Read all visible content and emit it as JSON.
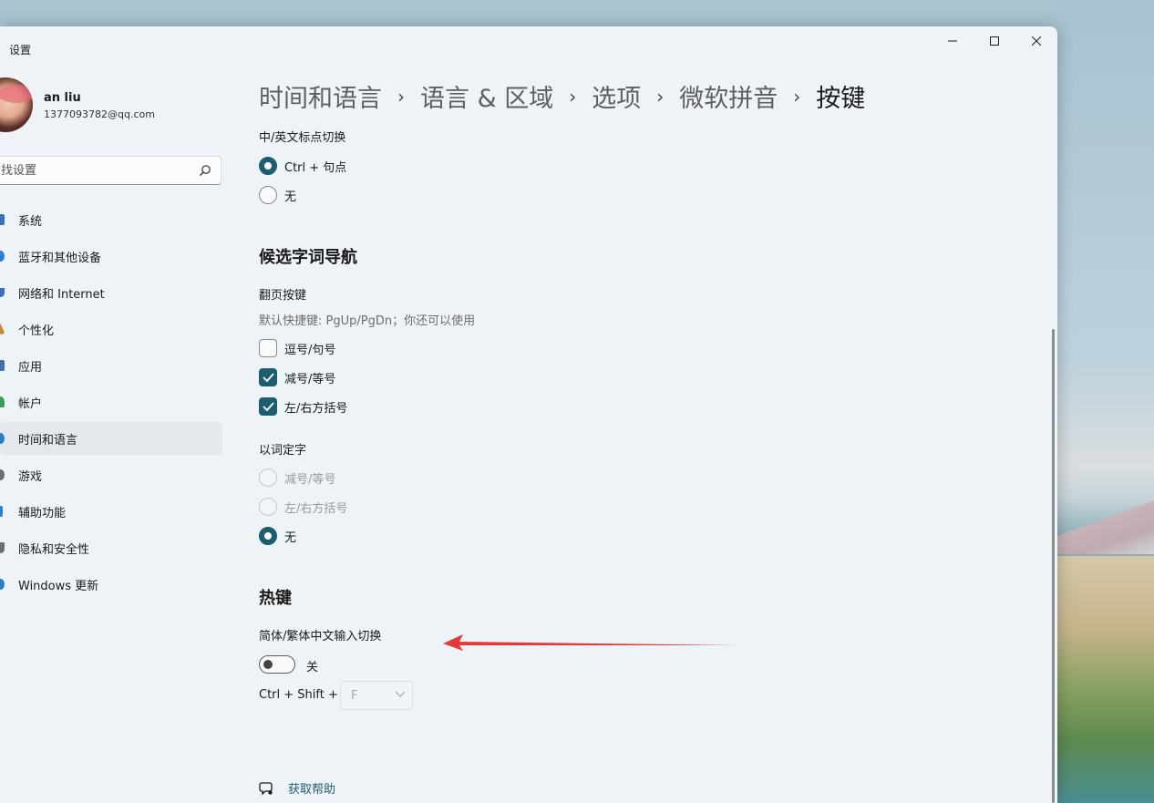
{
  "window": {
    "title": "设置",
    "minimize_icon": "minimize-icon",
    "maximize_icon": "maximize-icon",
    "close_icon": "close-icon"
  },
  "profile": {
    "name": "an liu",
    "email": "1377093782@qq.com"
  },
  "search": {
    "placeholder": "找设置",
    "icon": "search-icon"
  },
  "nav": {
    "items": [
      {
        "label": "系统",
        "icon": "system-icon",
        "color": "#3b6fb6"
      },
      {
        "label": "蓝牙和其他设备",
        "icon": "bluetooth-icon",
        "color": "#2f7fd0"
      },
      {
        "label": "网络和 Internet",
        "icon": "network-icon",
        "color": "#3b6fb6"
      },
      {
        "label": "个性化",
        "icon": "brush-icon",
        "color": "#c58a3a"
      },
      {
        "label": "应用",
        "icon": "apps-icon",
        "color": "#4a6fa8"
      },
      {
        "label": "帐户",
        "icon": "account-icon",
        "color": "#3f9a5a"
      },
      {
        "label": "时间和语言",
        "icon": "globe-icon",
        "color": "#2e7fc0"
      },
      {
        "label": "游戏",
        "icon": "game-icon",
        "color": "#6e6e6e"
      },
      {
        "label": "辅助功能",
        "icon": "accessibility-icon",
        "color": "#2e7fc0"
      },
      {
        "label": "隐私和安全性",
        "icon": "shield-icon",
        "color": "#6e6e6e"
      },
      {
        "label": "Windows 更新",
        "icon": "update-icon",
        "color": "#2e7fc0"
      }
    ],
    "active_index": 6
  },
  "breadcrumb": {
    "items": [
      "时间和语言",
      "语言 & 区域",
      "选项",
      "微软拼音"
    ],
    "current": "按键",
    "separator": "›"
  },
  "punctuation_switch": {
    "label": "中/英文标点切换",
    "options": [
      {
        "label": "Ctrl + 句点",
        "checked": true
      },
      {
        "label": "无",
        "checked": false
      }
    ]
  },
  "candidate_nav": {
    "title": "候选字词导航",
    "page_keys_label": "翻页按键",
    "page_keys_hint": "默认快捷键: PgUp/PgDn；你还可以使用",
    "page_keys_options": [
      {
        "label": "逗号/句号",
        "checked": false
      },
      {
        "label": "减号/等号",
        "checked": true
      },
      {
        "label": "左/右方括号",
        "checked": true
      }
    ],
    "word_select_label": "以词定字",
    "word_select_options": [
      {
        "label": "减号/等号",
        "checked": false,
        "disabled": true
      },
      {
        "label": "左/右方括号",
        "checked": false,
        "disabled": true
      },
      {
        "label": "无",
        "checked": true,
        "disabled": false
      }
    ]
  },
  "hotkeys": {
    "title": "热键",
    "sc_tc_label": "简体/繁体中文输入切换",
    "toggle_state": "关",
    "toggle_on": false,
    "shortcut_prefix": "Ctrl + Shift +",
    "shortcut_key": "F"
  },
  "help": {
    "label": "获取帮助",
    "icon": "help-chat-icon"
  },
  "colors": {
    "accent": "#1d5d70",
    "annotation_arrow": "#e5393a"
  }
}
